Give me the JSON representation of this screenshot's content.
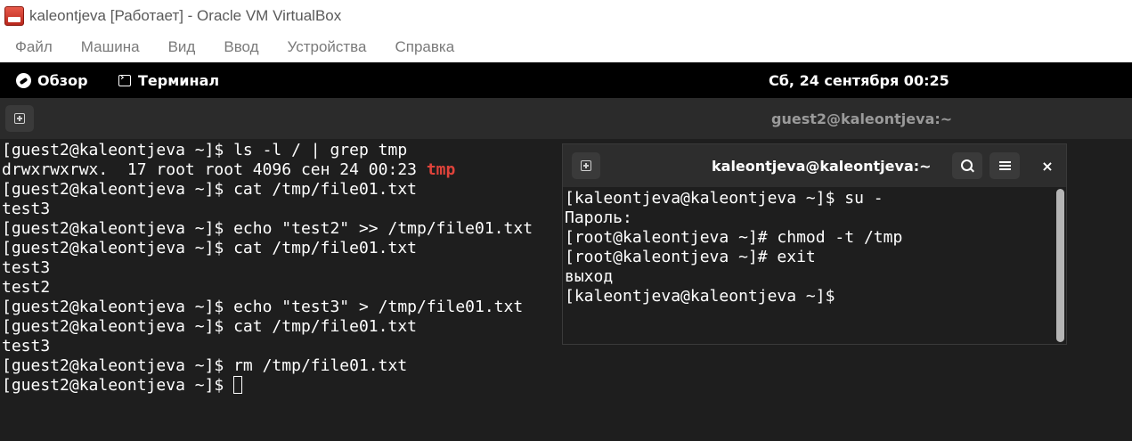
{
  "host_window": {
    "title": "kaleontjeva [Работает] - Oracle VM VirtualBox",
    "menu": [
      "Файл",
      "Машина",
      "Вид",
      "Ввод",
      "Устройства",
      "Справка"
    ]
  },
  "gnome_topbar": {
    "activities": "Обзор",
    "app_name": "Терминал",
    "clock": "Сб, 24 сентября  00:25"
  },
  "main_terminal": {
    "title": "guest2@kaleontjeva:~",
    "lines": [
      "[guest2@kaleontjeva ~]$ ls -l / | grep tmp",
      "drwxrwxrwx.  17 root root 4096 сен 24 00:23 ",
      "[guest2@kaleontjeva ~]$ cat /tmp/file01.txt",
      "test3",
      "[guest2@kaleontjeva ~]$ echo \"test2\" >> /tmp/file01.txt",
      "[guest2@kaleontjeva ~]$ cat /tmp/file01.txt",
      "test3",
      "test2",
      "[guest2@kaleontjeva ~]$ echo \"test3\" > /tmp/file01.txt",
      "[guest2@kaleontjeva ~]$ cat /tmp/file01.txt",
      "test3",
      "[guest2@kaleontjeva ~]$ rm /tmp/file01.txt",
      "[guest2@kaleontjeva ~]$ "
    ],
    "highlight_word": "tmp",
    "highlight_color": "#e0433b"
  },
  "second_terminal": {
    "title": "kaleontjeva@kaleontjeva:~",
    "close_glyph": "×",
    "lines": [
      "[kaleontjeva@kaleontjeva ~]$ su -",
      "Пароль:",
      "[root@kaleontjeva ~]# chmod -t /tmp",
      "[root@kaleontjeva ~]# exit",
      "выход",
      "[kaleontjeva@kaleontjeva ~]$"
    ]
  },
  "icons": {
    "app": "virtualbox-icon",
    "activities": "activities-icon",
    "terminal": "terminal-icon",
    "new_tab": "new-tab-icon",
    "search": "search-icon",
    "menu": "hamburger-menu-icon",
    "close": "close-icon"
  }
}
